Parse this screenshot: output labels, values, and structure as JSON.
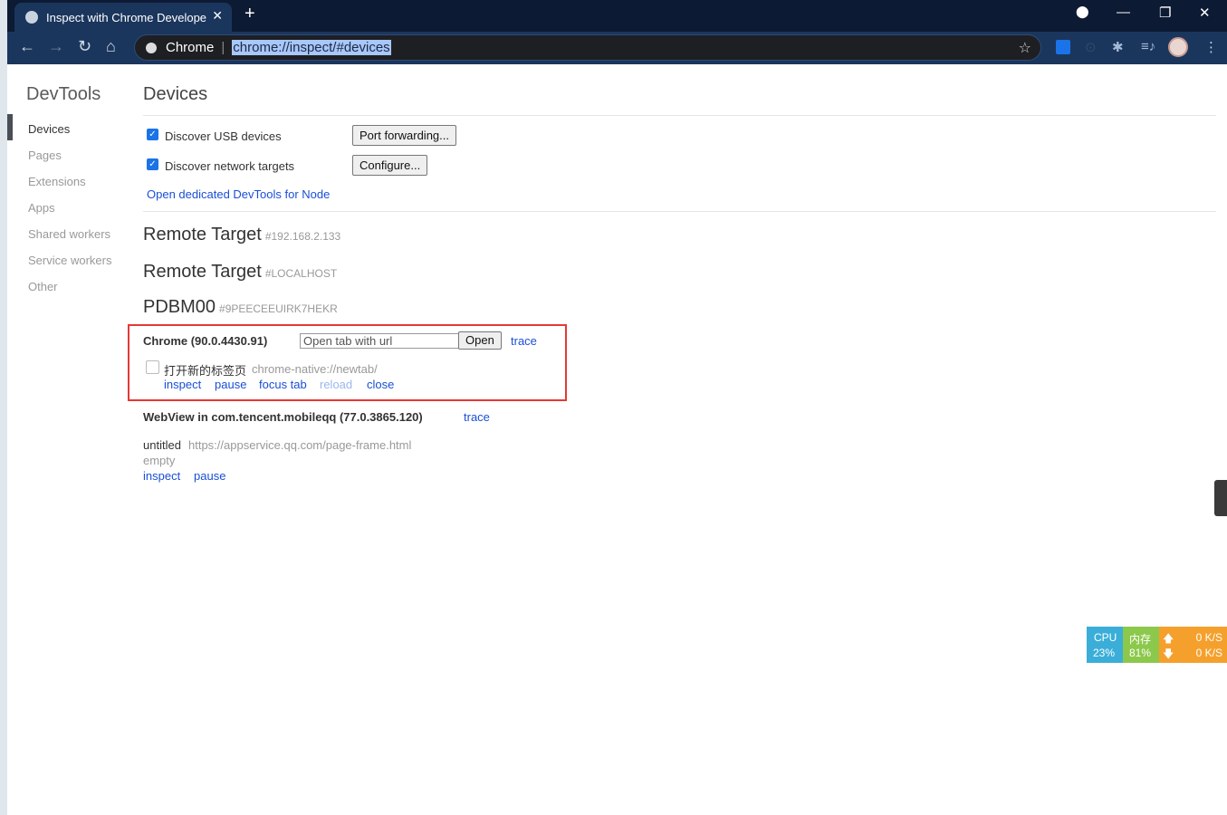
{
  "browser": {
    "tab_title": "Inspect with Chrome Develope",
    "omnibox_site": "Chrome",
    "url": "chrome://inspect/#devices"
  },
  "sidebar": {
    "title": "DevTools",
    "items": [
      {
        "label": "Devices",
        "selected": true
      },
      {
        "label": "Pages"
      },
      {
        "label": "Extensions"
      },
      {
        "label": "Apps"
      },
      {
        "label": "Shared workers"
      },
      {
        "label": "Service workers"
      },
      {
        "label": "Other"
      }
    ]
  },
  "main": {
    "title": "Devices",
    "discover_usb": "Discover USB devices",
    "discover_network": "Discover network targets",
    "port_forwarding": "Port forwarding...",
    "configure": "Configure...",
    "node_link": "Open dedicated DevTools for Node",
    "targets": [
      {
        "name": "Remote Target",
        "id": "#192.168.2.133"
      },
      {
        "name": "Remote Target",
        "id": "#LOCALHOST"
      },
      {
        "name": "PDBM00",
        "id": "#9PEECEEUIRK7HEKR"
      }
    ],
    "chrome": {
      "title": "Chrome (90.0.4430.91)",
      "url_placeholder": "Open tab with url",
      "open": "Open",
      "trace": "trace",
      "page_title": "打开新的标签页",
      "page_url": "chrome-native://newtab/",
      "actions": [
        "inspect",
        "pause",
        "focus tab",
        "reload",
        "close"
      ]
    },
    "webview": {
      "title": "WebView in com.tencent.mobileqq (77.0.3865.120)",
      "trace": "trace",
      "page_title": "untitled",
      "page_url": "https://appservice.qq.com/page-frame.html",
      "status": "empty",
      "actions": [
        "inspect",
        "pause"
      ]
    }
  },
  "meter": {
    "cpu_label": "CPU",
    "cpu": "23%",
    "mem_label": "内存",
    "mem": "81%",
    "up": "0 K/S",
    "down": "0 K/S",
    "colors": {
      "cpu": "#3aaed8",
      "mem": "#8cc84b",
      "net": "#f5a02c"
    }
  }
}
